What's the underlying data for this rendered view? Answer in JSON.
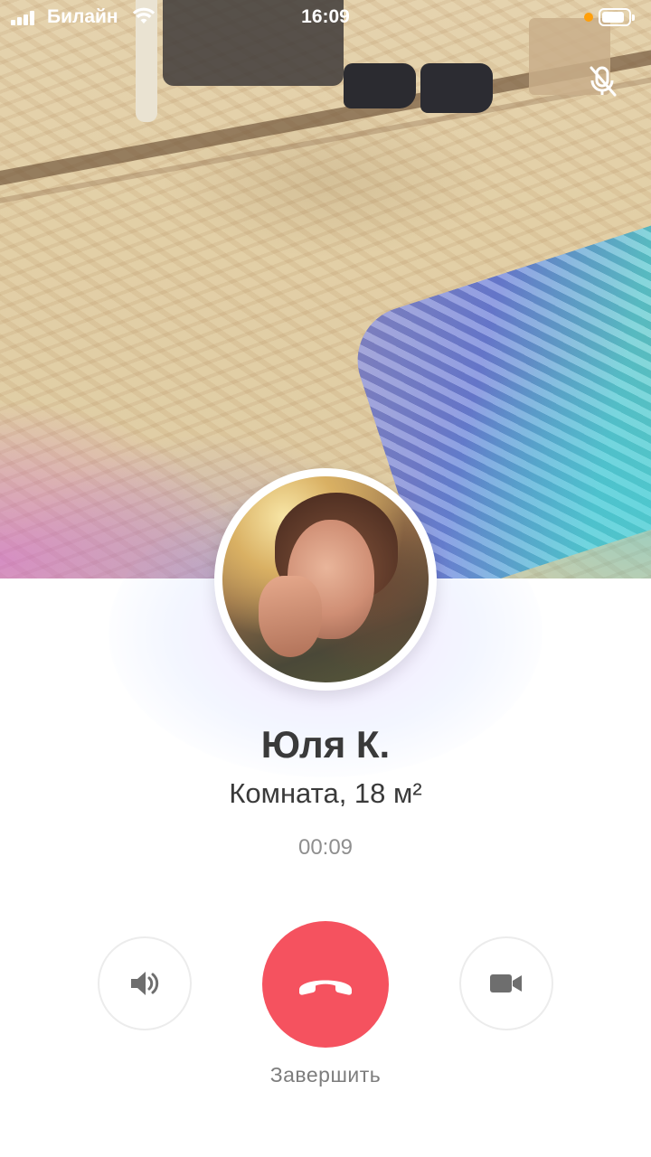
{
  "status_bar": {
    "carrier": "Билайн",
    "time": "16:09",
    "signal_bars": 4,
    "battery_level": 0.8
  },
  "video": {
    "mic_icon": "mic-off-icon"
  },
  "call": {
    "name": "Юля К.",
    "subtitle": "Комната, 18 м²",
    "timer": "00:09"
  },
  "controls": {
    "speaker_icon": "speaker-icon",
    "end_icon": "phone-hangup-icon",
    "video_icon": "video-camera-icon",
    "end_label": "Завершить"
  },
  "colors": {
    "end_call": "#f5525f",
    "text_primary": "#3a3a3a",
    "text_secondary": "#8f8f8f",
    "control_icon": "#6e6e6e"
  }
}
